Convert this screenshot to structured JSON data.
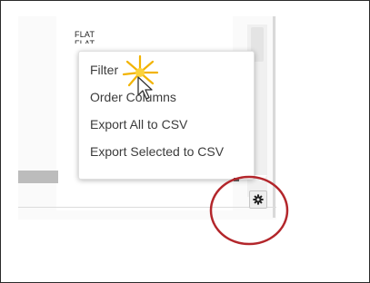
{
  "grid": {
    "cells": [
      "FLAT",
      "FLAT"
    ]
  },
  "menu": {
    "items": [
      {
        "label": "Filter"
      },
      {
        "label": "Order Columns"
      },
      {
        "label": "Export All to CSV"
      },
      {
        "label": "Export Selected to CSV"
      }
    ]
  },
  "icons": {
    "settings": "gear-icon",
    "cursor": "arrow-hand-cursor-icon",
    "click": "click-burst-icon"
  },
  "colors": {
    "highlight": "#b3262b",
    "burst": "#f2b300",
    "menu_text": "#3c3c3c"
  }
}
